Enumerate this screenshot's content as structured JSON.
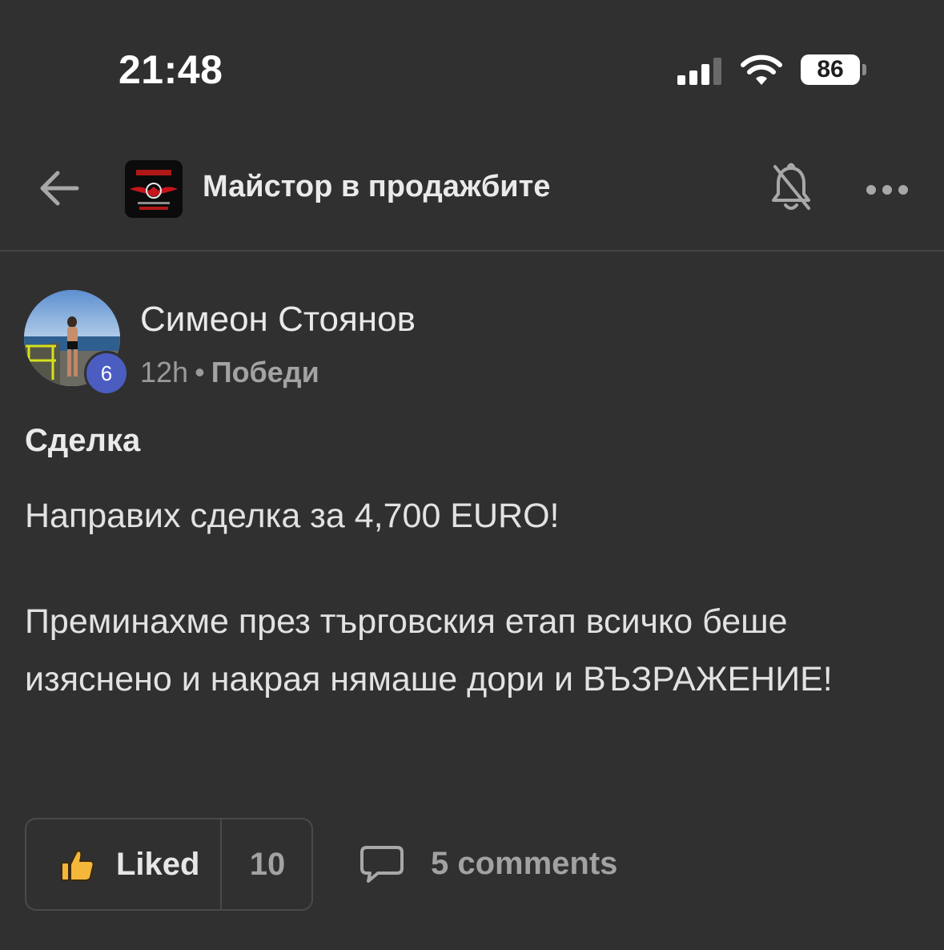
{
  "status_bar": {
    "time": "21:48",
    "battery": "86",
    "icons": [
      "signal-icon",
      "wifi-icon",
      "battery-icon"
    ]
  },
  "header": {
    "back_icon": "arrow-left-icon",
    "group_logo_icon": "group-logo",
    "title": "Майстор в продажбите",
    "bell_icon": "bell-muted-icon",
    "more_icon": "more-horizontal-icon"
  },
  "post": {
    "author": {
      "name": "Симеон Стоянов",
      "level": "6"
    },
    "time": "12h",
    "separator": "•",
    "category": "Победи",
    "title": "Сделка",
    "paragraphs": [
      "Направих сделка за 4,700 EURO!",
      "Преминахме през търговския етап всичко беше изяснено и накрая нямаше дори и ВЪЗРАЖЕНИЕ!"
    ],
    "actions": {
      "like_label": "Liked",
      "like_icon": "thumbs-up-icon",
      "like_count": "10",
      "comment_icon": "speech-bubble-icon",
      "comments_label": "5 comments"
    }
  },
  "colors": {
    "background": "#303030",
    "text": "#e9e9e9",
    "muted": "#9a9a9a",
    "level_badge": "#4b5dc1",
    "thumb": "#f4b73a"
  }
}
